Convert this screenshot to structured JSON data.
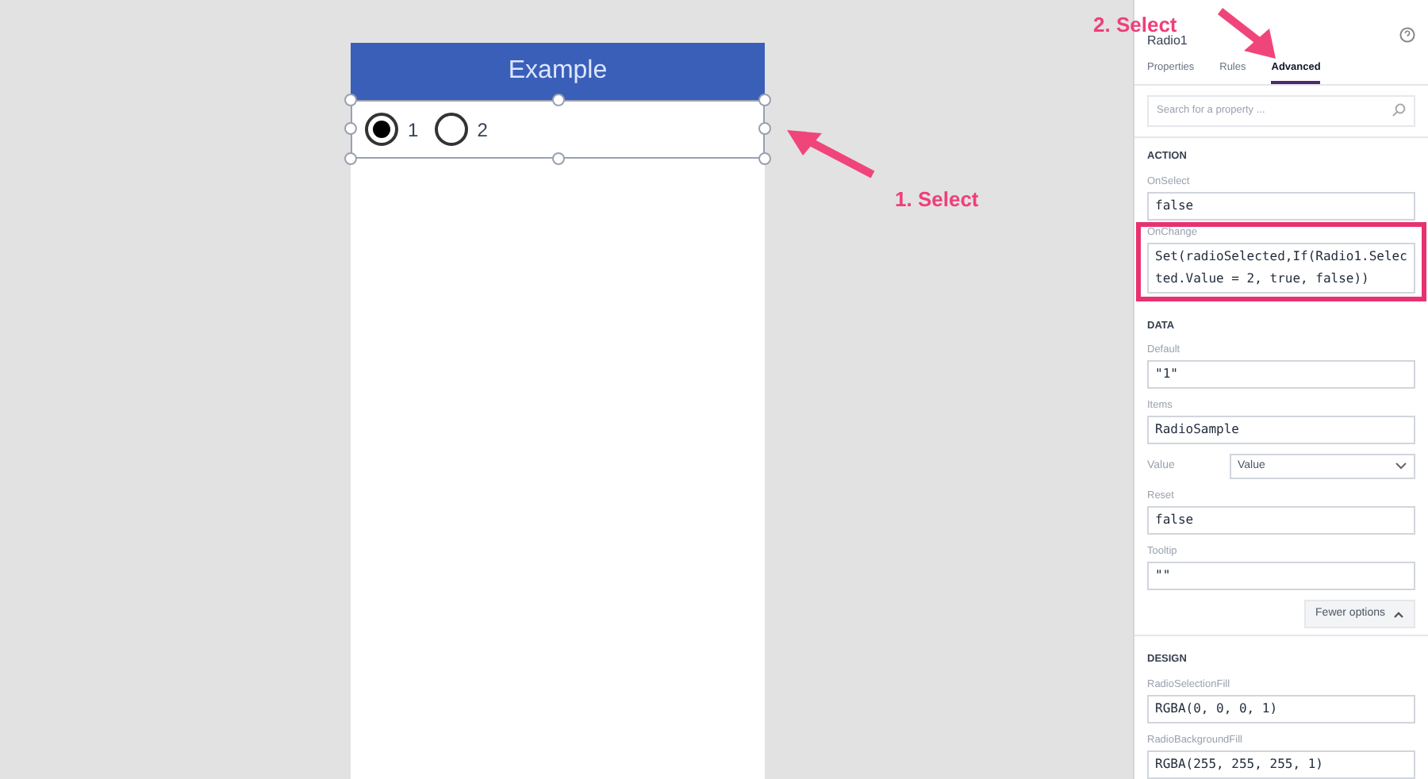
{
  "canvas": {
    "title": "Example",
    "radios": [
      {
        "label": "1",
        "selected": true
      },
      {
        "label": "2",
        "selected": false
      }
    ]
  },
  "annotations": [
    {
      "text": "1. Select"
    },
    {
      "text": "2. Select"
    }
  ],
  "panel": {
    "control_name": "Radio1",
    "tabs": [
      {
        "label": "Properties",
        "selected": false
      },
      {
        "label": "Rules",
        "selected": false
      },
      {
        "label": "Advanced",
        "selected": true
      }
    ],
    "search": {
      "placeholder": "Search for a property ..."
    },
    "sections": [
      {
        "title": "ACTION",
        "properties": [
          {
            "kind": "field",
            "label": "OnSelect",
            "value": "false"
          },
          {
            "kind": "field",
            "label": "OnChange",
            "value": "Set(radioSelected,If(Radio1.Selected.Value = 2, true, false))",
            "highlighted": true
          }
        ]
      },
      {
        "title": "DATA",
        "properties": [
          {
            "kind": "field",
            "label": "Default",
            "value": "\"1\""
          },
          {
            "kind": "field",
            "label": "Items",
            "value": "RadioSample"
          },
          {
            "kind": "dropdown",
            "label": "Value",
            "value": "Value"
          },
          {
            "kind": "field",
            "label": "Reset",
            "value": "false"
          },
          {
            "kind": "field",
            "label": "Tooltip",
            "value": "\"\""
          }
        ],
        "button": "Fewer options"
      },
      {
        "title": "DESIGN",
        "properties": [
          {
            "kind": "field",
            "label": "RadioSelectionFill",
            "value": "RGBA(0, 0, 0, 1)"
          },
          {
            "kind": "field",
            "label": "RadioBackgroundFill",
            "value": "RGBA(255, 255, 255, 1)"
          }
        ]
      }
    ]
  }
}
